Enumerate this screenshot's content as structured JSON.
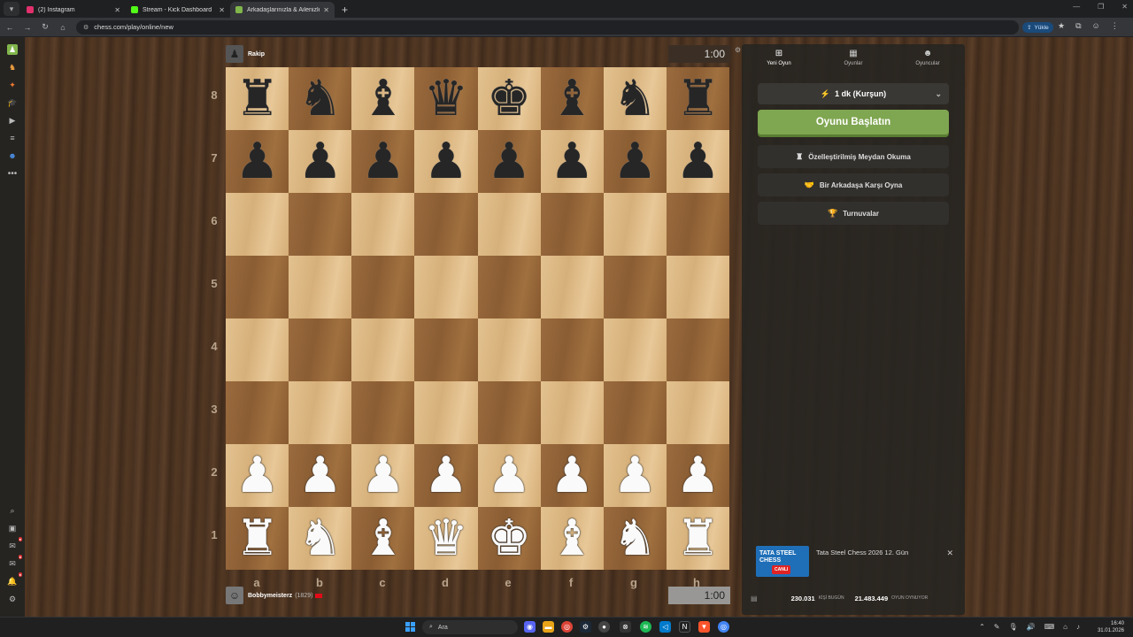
{
  "browser": {
    "tabs": [
      {
        "title": "(2) Instagram",
        "color": "#e1306c",
        "active": false
      },
      {
        "title": "Stream - Kick Dashboard",
        "color": "#53fc18",
        "active": false
      },
      {
        "title": "Arkadaşlarınızla & Ailenizle Üc...",
        "color": "#81b64c",
        "active": true
      }
    ],
    "url": "chess.com/play/online/new",
    "upload_label": "Yükle"
  },
  "top_player": {
    "name": "Rakip",
    "clock": "1:00"
  },
  "bottom_player": {
    "name": "Bobbymeisterz",
    "rating": "(1829)",
    "clock": "1:00"
  },
  "board": {
    "ranks": [
      "8",
      "7",
      "6",
      "5",
      "4",
      "3",
      "2",
      "1"
    ],
    "files": [
      "a",
      "b",
      "c",
      "d",
      "e",
      "f",
      "g",
      "h"
    ],
    "position": [
      [
        "br",
        "bn",
        "bb",
        "bq",
        "bk",
        "bb",
        "bn",
        "br"
      ],
      [
        "bp",
        "bp",
        "bp",
        "bp",
        "bp",
        "bp",
        "bp",
        "bp"
      ],
      [
        "",
        "",
        "",
        "",
        "",
        "",
        "",
        ""
      ],
      [
        "",
        "",
        "",
        "",
        "",
        "",
        "",
        ""
      ],
      [
        "",
        "",
        "",
        "",
        "",
        "",
        "",
        ""
      ],
      [
        "",
        "",
        "",
        "",
        "",
        "",
        "",
        ""
      ],
      [
        "wp",
        "wp",
        "wp",
        "wp",
        "wp",
        "wp",
        "wp",
        "wp"
      ],
      [
        "wr",
        "wn",
        "wb",
        "wq",
        "wk",
        "wb",
        "wn",
        "wr"
      ]
    ]
  },
  "panel": {
    "tabs": [
      {
        "label": "Yeni Oyun",
        "icon": "plus-icon"
      },
      {
        "label": "Oyunlar",
        "icon": "grid-icon"
      },
      {
        "label": "Oyuncular",
        "icon": "users-icon"
      }
    ],
    "time_control": "1 dk (Kurşun)",
    "start_button": "Oyunu Başlatın",
    "options": [
      {
        "label": "Özelleştirilmiş Meydan Okuma",
        "icon": "custom-icon"
      },
      {
        "label": "Bir Arkadaşa Karşı Oyna",
        "icon": "handshake-icon"
      },
      {
        "label": "Turnuvalar",
        "icon": "trophy-icon"
      }
    ],
    "event": {
      "logo_text": "TATA STEEL CHESS",
      "live": "CANLI",
      "title": "Tata Steel Chess 2026 12. Gün"
    },
    "stats": {
      "players_today": "230.031",
      "players_today_label": "KİŞİ BUGÜN",
      "playing_now": "21.483.449",
      "playing_now_label": "OYUN OYNUYOR"
    }
  },
  "taskbar": {
    "search_placeholder": "Ara",
    "time": "16:40",
    "date": "31.01.2026"
  }
}
